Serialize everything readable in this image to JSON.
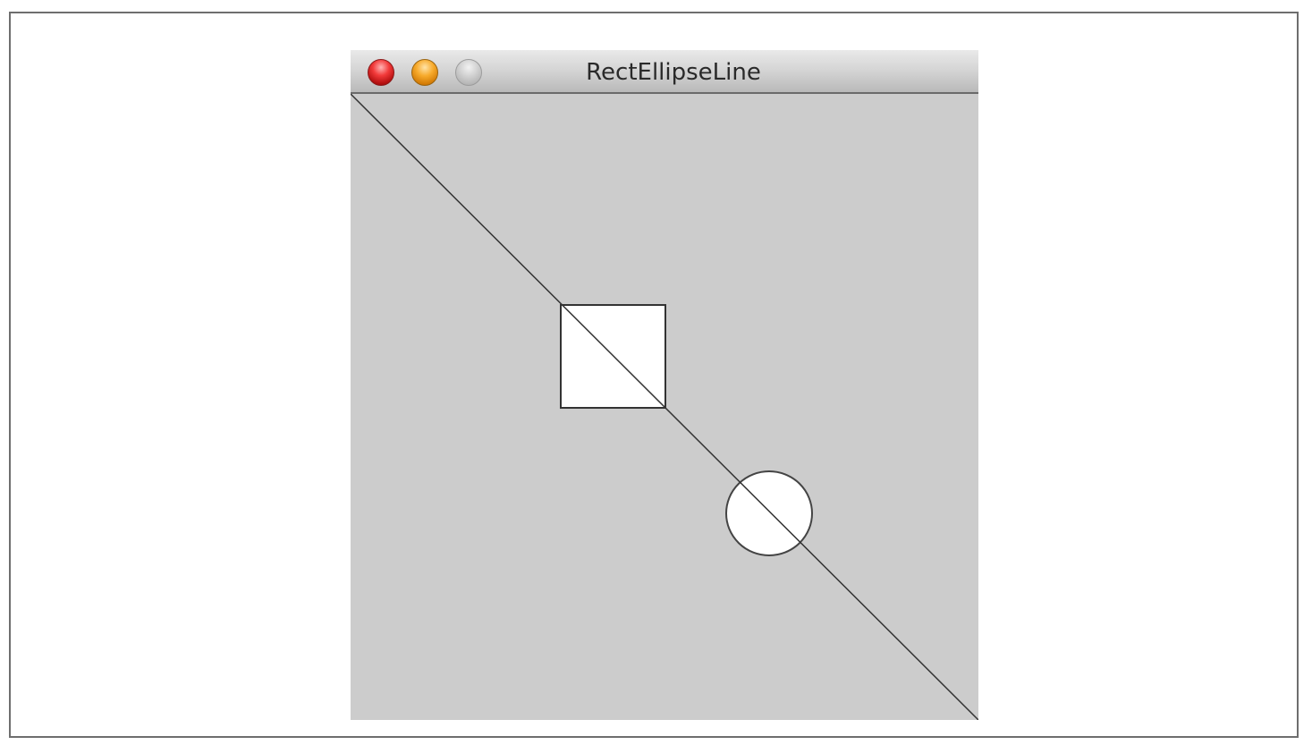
{
  "window": {
    "title": "RectEllipseLine",
    "controls": {
      "close": "close-button",
      "minimize": "minimize-button",
      "zoom": "zoom-button"
    }
  },
  "canvas": {
    "background_color": "#cccccc",
    "shapes": [
      {
        "kind": "line",
        "stroke": "#333333"
      },
      {
        "kind": "rect",
        "fill": "#ffffff",
        "stroke": "#333333"
      },
      {
        "kind": "ellipse",
        "fill": "#ffffff",
        "stroke": "#333333"
      }
    ]
  }
}
